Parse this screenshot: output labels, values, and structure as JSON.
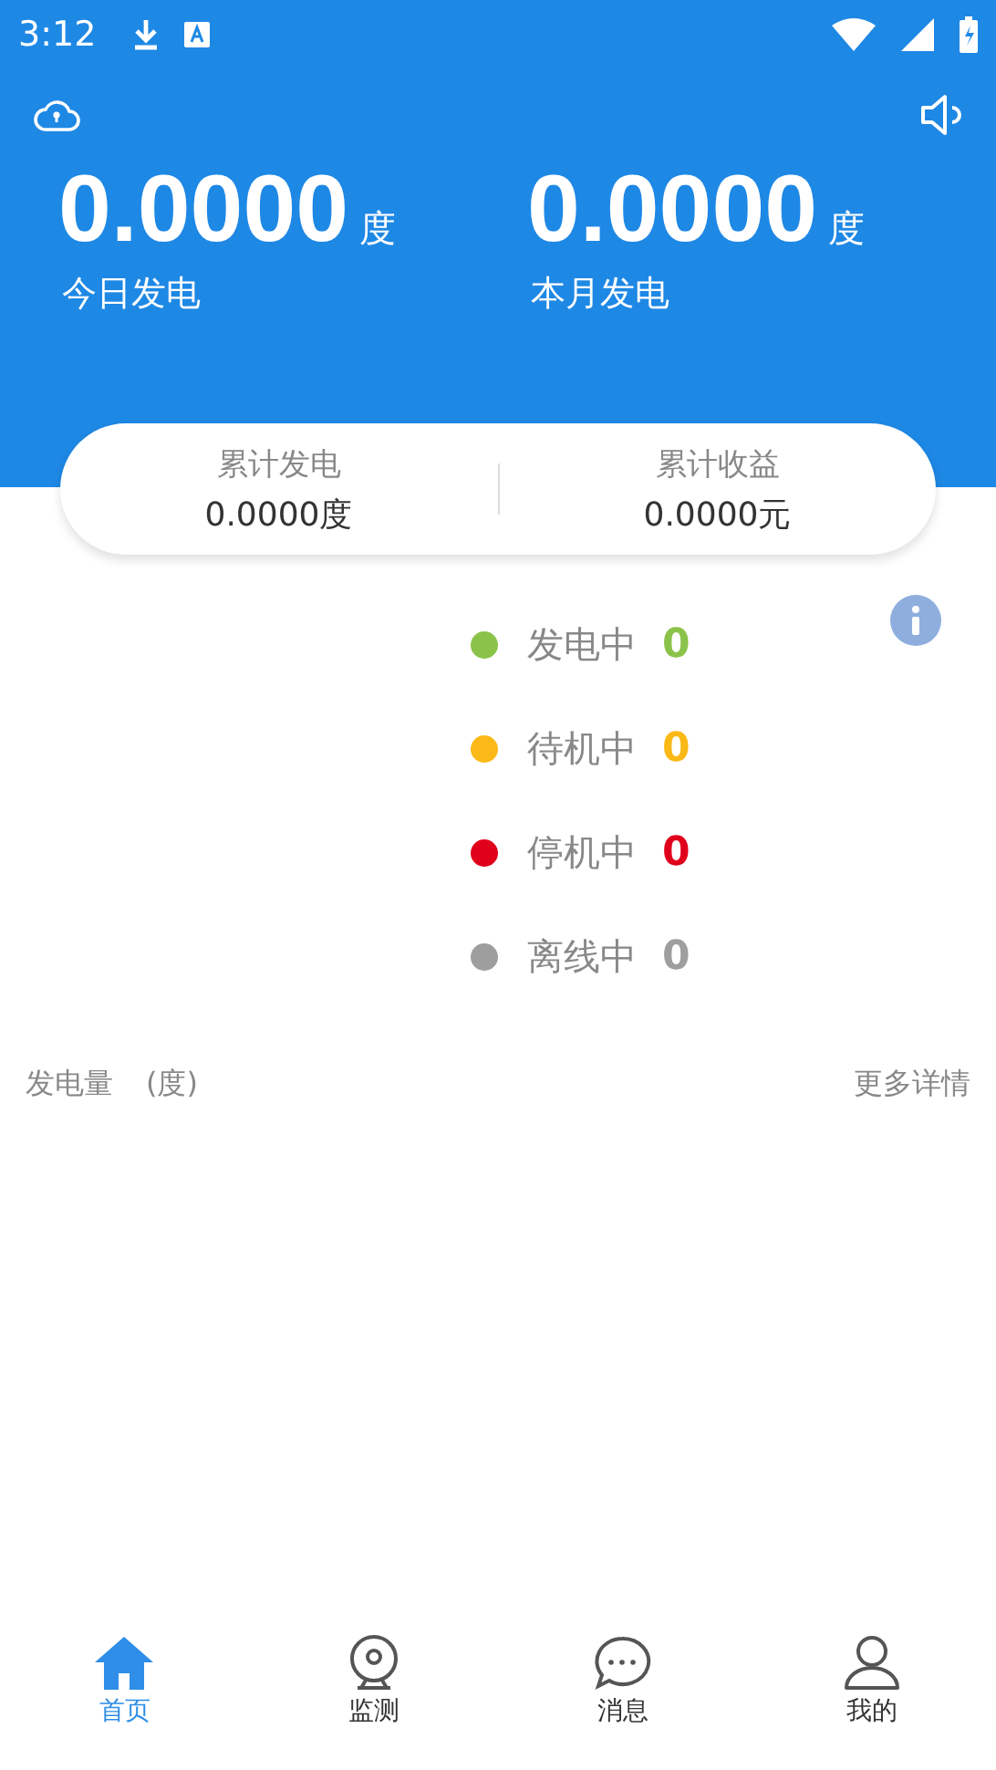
{
  "status_bar": {
    "time": "3:12"
  },
  "today": {
    "value": "0.0000",
    "unit": "度",
    "label": "今日发电"
  },
  "month": {
    "value": "0.0000",
    "unit": "度",
    "label": "本月发电"
  },
  "totals": [
    {
      "label": "累计发电",
      "value": "0.0000",
      "unit": "度"
    },
    {
      "label": "累计收益",
      "value": "0.0000",
      "unit": "元"
    }
  ],
  "statuses": [
    {
      "label": "发电中",
      "count": "0",
      "color": "#8bc34a"
    },
    {
      "label": "待机中",
      "count": "0",
      "color": "#fbb917"
    },
    {
      "label": "停机中",
      "count": "0",
      "color": "#e0001b"
    },
    {
      "label": "离线中",
      "count": "0",
      "color": "#9e9e9e"
    }
  ],
  "chart_header": {
    "title": "发电量",
    "unit": "(度)",
    "more": "更多详情"
  },
  "tabs": [
    {
      "label": "首页",
      "kind": "home",
      "selected": true
    },
    {
      "label": "监测",
      "kind": "monitor",
      "selected": false
    },
    {
      "label": "消息",
      "kind": "message",
      "selected": false
    },
    {
      "label": "我的",
      "kind": "profile",
      "selected": false
    }
  ]
}
